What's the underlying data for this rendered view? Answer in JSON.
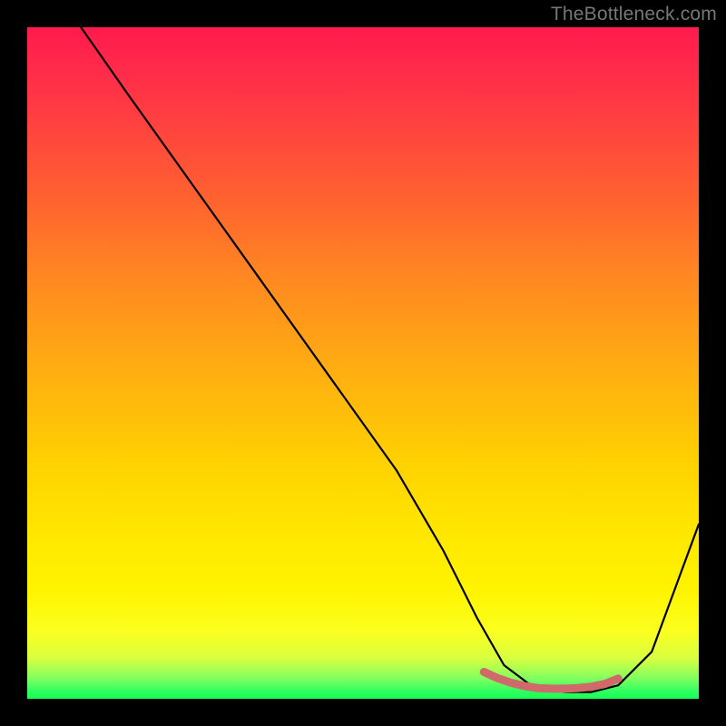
{
  "watermark": "TheBottleneck.com",
  "chart_data": {
    "type": "line",
    "title": "",
    "xlabel": "",
    "ylabel": "",
    "xlim": [
      0,
      100
    ],
    "ylim": [
      0,
      100
    ],
    "series": [
      {
        "name": "bottleneck-curve",
        "x": [
          0,
          8,
          15,
          25,
          35,
          45,
          55,
          62,
          67,
          71,
          75,
          80,
          84,
          88,
          93,
          100
        ],
        "values": [
          110,
          100,
          90,
          76,
          62,
          48,
          34,
          22,
          12,
          5,
          2,
          1,
          1,
          2,
          7,
          26
        ],
        "color": "#000000"
      },
      {
        "name": "optimal-range-marker",
        "x": [
          68,
          70,
          72,
          74,
          76,
          78,
          80,
          82,
          84,
          86,
          88
        ],
        "values": [
          4,
          3.1,
          2.4,
          1.9,
          1.6,
          1.5,
          1.5,
          1.6,
          1.8,
          2.2,
          3.0
        ],
        "color": "#d06a6a"
      }
    ],
    "gradient_stops": [
      {
        "pos": 0.0,
        "color": "#ff1a4d"
      },
      {
        "pos": 0.25,
        "color": "#ff6030"
      },
      {
        "pos": 0.5,
        "color": "#ffb010"
      },
      {
        "pos": 0.75,
        "color": "#ffe800"
      },
      {
        "pos": 0.95,
        "color": "#d8ff40"
      },
      {
        "pos": 1.0,
        "color": "#1aff55"
      }
    ]
  }
}
